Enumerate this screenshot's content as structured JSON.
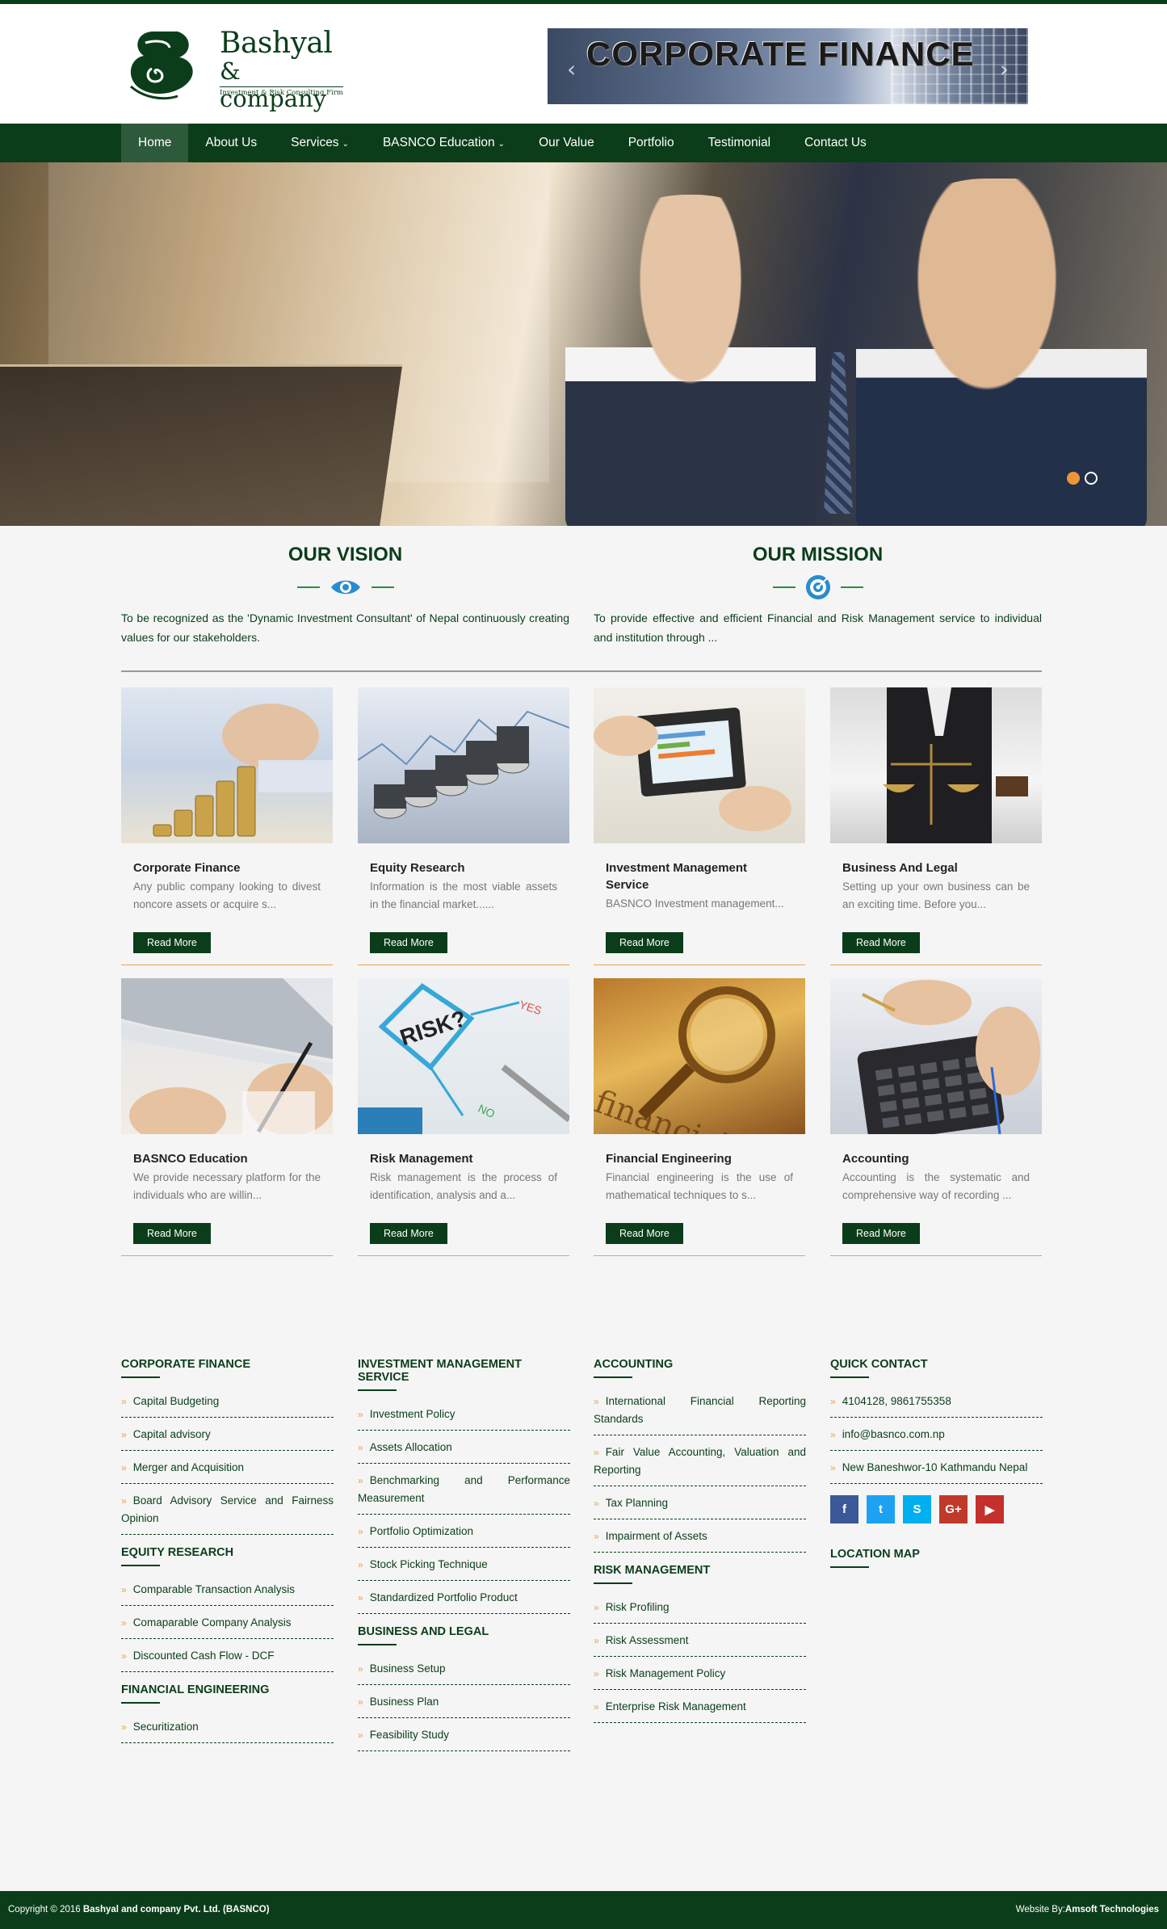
{
  "brand": {
    "name": "Bashyal",
    "company": "& company",
    "tagline": "Investment & Risk Consulting Firm",
    "color": "#0b3d1a",
    "accent": "#e8a34a"
  },
  "top_banner": {
    "text": "CORPORATE FINANCE",
    "prev_icon": "chevron-left",
    "next_icon": "chevron-right"
  },
  "nav": {
    "items": [
      {
        "label": "Home"
      },
      {
        "label": "About Us"
      },
      {
        "label": "Services",
        "caret": "⌄"
      },
      {
        "label": "BASNCO Education",
        "caret": "⌄"
      },
      {
        "label": "Our Value"
      },
      {
        "label": "Portfolio"
      },
      {
        "label": "Testimonial"
      },
      {
        "label": "Contact Us"
      }
    ],
    "active": "Home"
  },
  "slider": {
    "slide_count": 2,
    "active_index": 0
  },
  "vision": {
    "title": "OUR VISION",
    "icon": "eye-icon",
    "text": "To be recognized as the 'Dynamic Investment Consultant' of Nepal continuously creating values for our stakeholders."
  },
  "mission": {
    "title": "OUR MISSION",
    "icon": "target-icon",
    "text": "To provide effective and efficient Financial and Risk Management service to individual and institution through ..."
  },
  "services": [
    {
      "title": "Corporate Finance",
      "desc": "Any public company looking to divest noncore assets or acquire s...",
      "button": "Read More"
    },
    {
      "title": "Equity Research",
      "desc": "Information is the most viable assets in the financial market......",
      "button": "Read More"
    },
    {
      "title": "Investment Management Service",
      "desc": "BASNCO Investment management...",
      "button": "Read More"
    },
    {
      "title": "Business And Legal",
      "desc": "Setting up your own business can be an exciting time. Before you...",
      "button": "Read More"
    },
    {
      "title": "BASNCO Education",
      "desc": "We provide necessary platform for the individuals who are willin...",
      "button": "Read More"
    },
    {
      "title": "Risk Management",
      "desc": "Risk management is the process of identification, analysis and a...",
      "button": "Read More"
    },
    {
      "title": "Financial Engineering",
      "desc": "Financial engineering is the use of mathematical techniques to s...",
      "button": "Read More"
    },
    {
      "title": "Accounting",
      "desc": "Accounting is the systematic and comprehensive way of recording ...",
      "button": "Read More"
    }
  ],
  "footer": {
    "col1": [
      {
        "heading": "CORPORATE FINANCE",
        "links": [
          "Capital Budgeting",
          "Capital advisory",
          "Merger and Acquisition",
          "Board Advisory Service and Fairness Opinion"
        ]
      },
      {
        "heading": "EQUITY RESEARCH",
        "links": [
          "Comparable Transaction Analysis",
          "Comaparable Company Analysis",
          "Discounted Cash Flow - DCF"
        ]
      },
      {
        "heading": "FINANCIAL ENGINEERING",
        "links": [
          "Securitization"
        ]
      }
    ],
    "col2": [
      {
        "heading": "INVESTMENT MANAGEMENT SERVICE",
        "links": [
          "Investment Policy",
          "Assets Allocation",
          "Benchmarking and Performance Measurement",
          "Portfolio Optimization",
          "Stock Picking Technique",
          "Standardized Portfolio Product"
        ]
      },
      {
        "heading": "BUSINESS AND LEGAL",
        "links": [
          "Business Setup",
          "Business Plan",
          "Feasibility Study"
        ]
      }
    ],
    "col3": [
      {
        "heading": "ACCOUNTING",
        "links": [
          "International Financial Reporting Standards",
          "Fair Value Accounting, Valuation and Reporting",
          "Tax Planning",
          "Impairment of Assets"
        ]
      },
      {
        "heading": "RISK MANAGEMENT",
        "links": [
          "Risk Profiling",
          "Risk Assessment",
          "Risk Management Policy",
          "Enterprise Risk Management"
        ]
      }
    ],
    "contact": {
      "heading": "QUICK CONTACT",
      "items": [
        "4104128, 9861755358",
        "info@basnco.com.np",
        "New Baneshwor-10 Kathmandu Nepal"
      ],
      "social": [
        {
          "name": "facebook-icon",
          "glyph": "f",
          "color": "#3b5998"
        },
        {
          "name": "twitter-icon",
          "glyph": "t",
          "color": "#1da1f2"
        },
        {
          "name": "skype-icon",
          "glyph": "S",
          "color": "#00aff0"
        },
        {
          "name": "google-plus-icon",
          "glyph": "G+",
          "color": "#c0392b"
        },
        {
          "name": "youtube-icon",
          "glyph": "▶",
          "color": "#c4302b"
        }
      ],
      "map_heading": "LOCATION MAP"
    }
  },
  "copyright": {
    "prefix": "Copyright © 2016 ",
    "company": "Bashyal and company Pvt. Ltd. (BASNCO)",
    "credit_prefix": "Website By:",
    "credit": "Amsoft Technologies"
  }
}
